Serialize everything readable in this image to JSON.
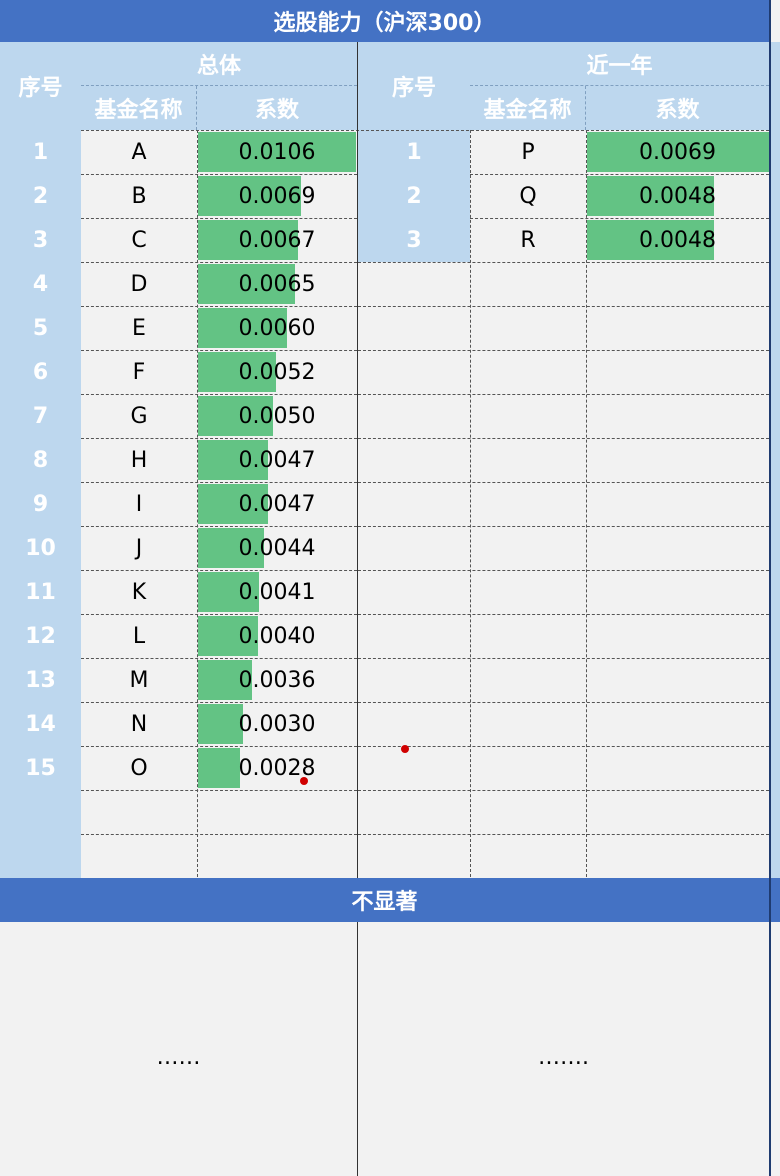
{
  "title": "选股能力（沪深300）",
  "left_section": {
    "seq_header": "序号",
    "group_header": "总体",
    "name_header": "基金名称",
    "coef_header": "系数",
    "rows": [
      {
        "seq": "1",
        "name": "A",
        "coef": "0.0106",
        "value": 0.0106
      },
      {
        "seq": "2",
        "name": "B",
        "coef": "0.0069",
        "value": 0.0069
      },
      {
        "seq": "3",
        "name": "C",
        "coef": "0.0067",
        "value": 0.0067
      },
      {
        "seq": "4",
        "name": "D",
        "coef": "0.0065",
        "value": 0.0065
      },
      {
        "seq": "5",
        "name": "E",
        "coef": "0.0060",
        "value": 0.006
      },
      {
        "seq": "6",
        "name": "F",
        "coef": "0.0052",
        "value": 0.0052
      },
      {
        "seq": "7",
        "name": "G",
        "coef": "0.0050",
        "value": 0.005
      },
      {
        "seq": "8",
        "name": "H",
        "coef": "0.0047",
        "value": 0.0047
      },
      {
        "seq": "9",
        "name": "I",
        "coef": "0.0047",
        "value": 0.0047
      },
      {
        "seq": "10",
        "name": "J",
        "coef": "0.0044",
        "value": 0.0044
      },
      {
        "seq": "11",
        "name": "K",
        "coef": "0.0041",
        "value": 0.0041
      },
      {
        "seq": "12",
        "name": "L",
        "coef": "0.0040",
        "value": 0.004
      },
      {
        "seq": "13",
        "name": "M",
        "coef": "0.0036",
        "value": 0.0036
      },
      {
        "seq": "14",
        "name": "N",
        "coef": "0.0030",
        "value": 0.003
      },
      {
        "seq": "15",
        "name": "O",
        "coef": "0.0028",
        "value": 0.0028
      }
    ]
  },
  "right_section": {
    "seq_header": "序号",
    "group_header": "近一年",
    "name_header": "基金名称",
    "coef_header": "系数",
    "rows": [
      {
        "seq": "1",
        "name": "P",
        "coef": "0.0069",
        "value": 0.0069
      },
      {
        "seq": "2",
        "name": "Q",
        "coef": "0.0048",
        "value": 0.0048
      },
      {
        "seq": "3",
        "name": "R",
        "coef": "0.0048",
        "value": 0.0048
      }
    ]
  },
  "not_significant": {
    "header": "不显著",
    "left_text": "……",
    "right_text": "……."
  },
  "colors": {
    "title_bg": "#4472c4",
    "header_bg": "#bdd7ee",
    "bar": "#63c384",
    "cell_bg": "#f2f2f2"
  }
}
